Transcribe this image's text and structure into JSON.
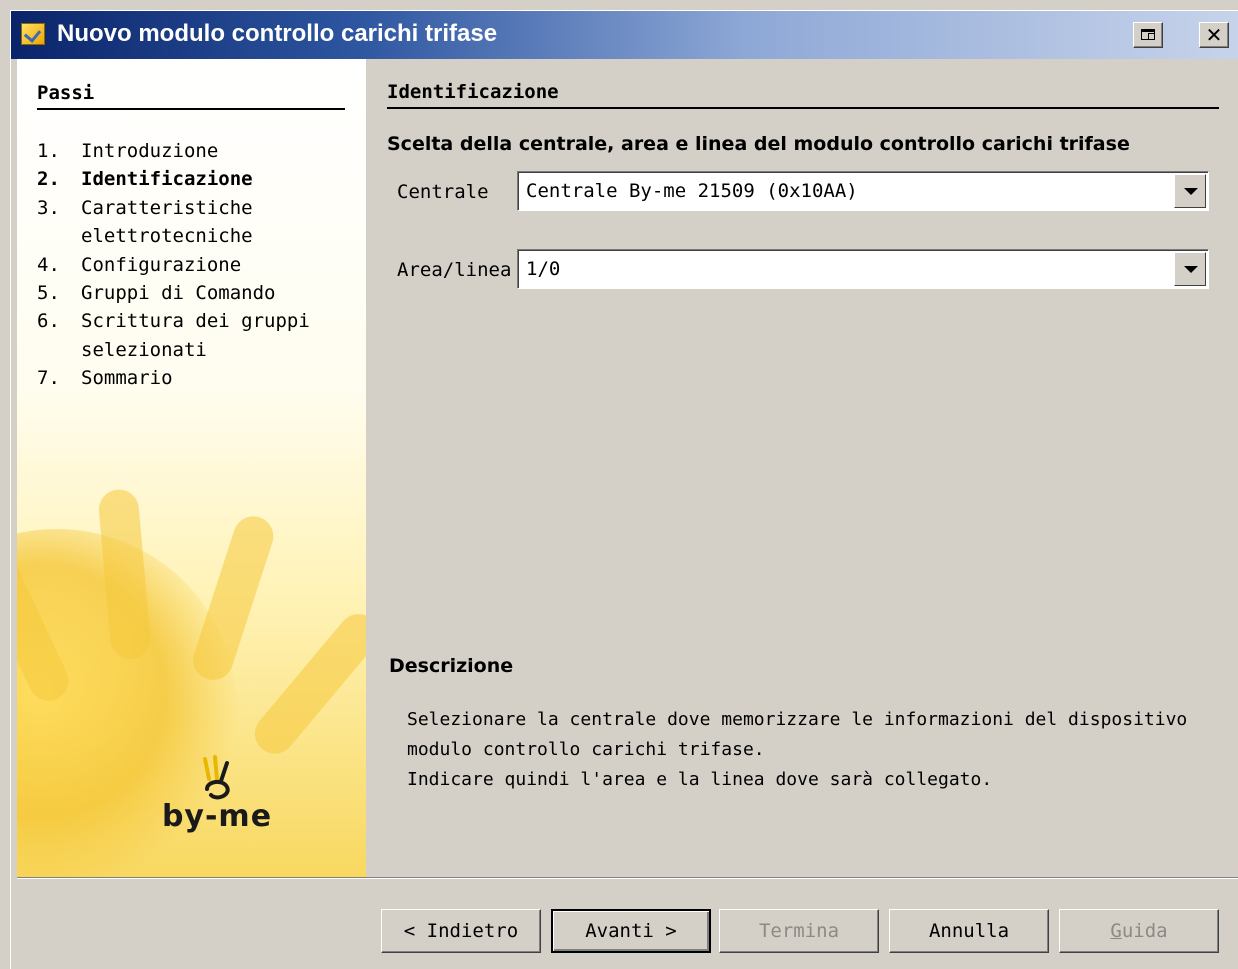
{
  "window": {
    "title": "Nuovo modulo controllo carichi trifase",
    "title_icon": "wizard-icon",
    "controls": {
      "restore": "restore-icon",
      "close": "✕"
    }
  },
  "steps": {
    "title": "Passi",
    "items": [
      {
        "num": "1.",
        "label": "Introduzione",
        "active": false
      },
      {
        "num": "2.",
        "label": "Identificazione",
        "active": true
      },
      {
        "num": "3.",
        "label": "Caratteristiche elettrotecniche",
        "active": false
      },
      {
        "num": "4.",
        "label": "Configurazione",
        "active": false
      },
      {
        "num": "5.",
        "label": "Gruppi di Comando",
        "active": false
      },
      {
        "num": "6.",
        "label": "Scrittura dei gruppi selezionati",
        "active": false
      },
      {
        "num": "7.",
        "label": "Sommario",
        "active": false
      }
    ],
    "logo_text": "by-me"
  },
  "main": {
    "section_title": "Identificazione",
    "subtitle": "Scelta della centrale, area e linea del modulo controllo carichi trifase",
    "fields": {
      "centrale": {
        "label": "Centrale",
        "value": "Centrale By-me 21509 (0x10AA)"
      },
      "area_linea": {
        "label": "Area/linea",
        "value": "1/0"
      }
    },
    "description": {
      "title": "Descrizione",
      "lines": [
        "Selezionare la centrale dove memorizzare le informazioni del dispositivo",
        "modulo controllo carichi trifase.",
        "Indicare quindi l'area e la linea dove sarà collegato."
      ]
    }
  },
  "buttons": {
    "back": "< Indietro",
    "next": "Avanti >",
    "finish": "Termina",
    "cancel": "Annulla",
    "help": "Guida"
  },
  "colors": {
    "titlebar_start": "#0a246a",
    "titlebar_end": "#c7d3ea",
    "dialog_bg": "#d4d0c8",
    "panel_yellow": "#f8d860",
    "disabled_text": "#8c8a86"
  }
}
